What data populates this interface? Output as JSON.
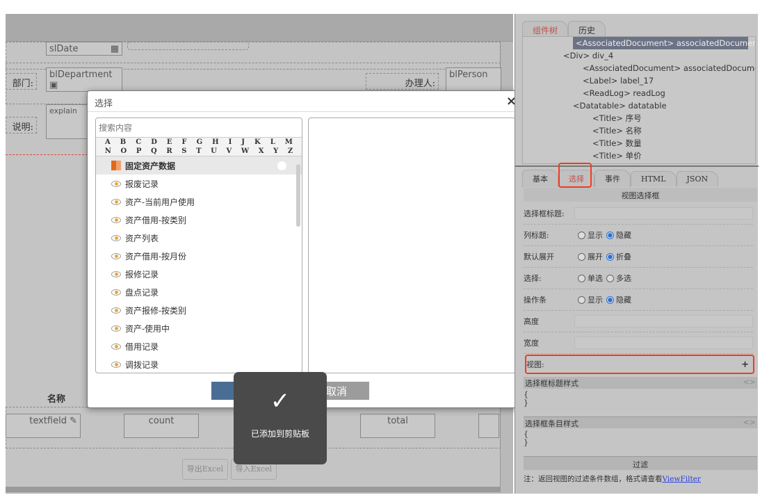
{
  "form": {
    "slDate": "slDate",
    "department_label": "部门:",
    "blDepartment": "blDepartment",
    "handler_label": "办理人:",
    "blPerson": "blPerson",
    "explain_label": "说明:",
    "explain": "explain",
    "col_name": "名称",
    "textfield": "textfield",
    "count": "count",
    "total": "total",
    "export_excel": "导出Excel",
    "import_excel": "导入Excel"
  },
  "dialog": {
    "title": "选择",
    "close": "×",
    "search_placeholder": "搜索内容",
    "alphabet_row1": [
      "A",
      "B",
      "C",
      "D",
      "E",
      "F",
      "G",
      "H",
      "I",
      "J",
      "K",
      "L",
      "M"
    ],
    "alphabet_row2": [
      "N",
      "O",
      "P",
      "Q",
      "R",
      "S",
      "T",
      "U",
      "V",
      "W",
      "X",
      "Y",
      "Z"
    ],
    "items": [
      {
        "label": "固定资产数据",
        "icon": "grid-icon",
        "selected": true
      },
      {
        "label": "报废记录",
        "icon": "eye-icon"
      },
      {
        "label": "资产-当前用户使用",
        "icon": "eye-icon"
      },
      {
        "label": "资产借用-按类别",
        "icon": "eye-icon"
      },
      {
        "label": "资产列表",
        "icon": "eye-icon"
      },
      {
        "label": "资产借用-按月份",
        "icon": "eye-icon"
      },
      {
        "label": "报修记录",
        "icon": "eye-icon"
      },
      {
        "label": "盘点记录",
        "icon": "eye-icon"
      },
      {
        "label": "资产报修-按类别",
        "icon": "eye-icon"
      },
      {
        "label": "资产-使用中",
        "icon": "eye-icon"
      },
      {
        "label": "借用记录",
        "icon": "eye-icon"
      },
      {
        "label": "调拨记录",
        "icon": "eye-icon"
      }
    ],
    "cancel": "取消"
  },
  "toast": {
    "message": "已添加到剪贴板",
    "icon": "checkmark-icon"
  },
  "panel": {
    "tabs_top": [
      "组件树",
      "历史"
    ],
    "tree": [
      {
        "label": "<AssociatedDocument> associatedDocument",
        "selected": true
      },
      {
        "label": "<Div> div_4"
      },
      {
        "label": "<AssociatedDocument> associatedDocument"
      },
      {
        "label": "<Label> label_17"
      },
      {
        "label": "<ReadLog> readLog"
      },
      {
        "label": "<Datatable> datatable"
      },
      {
        "label": "<Title> 序号"
      },
      {
        "label": "<Title> 名称"
      },
      {
        "label": "<Title> 数量"
      },
      {
        "label": "<Title> 单价"
      }
    ],
    "tabs": [
      "基本",
      "选择",
      "事件",
      "HTML",
      "JSON"
    ],
    "section_title": "视图选择框",
    "fields": {
      "title_label": "选择框标题:",
      "col_title_label": "列标题:",
      "show": "显示",
      "hide": "隐藏",
      "expand_label": "默认展开",
      "expand": "展开",
      "collapse": "折叠",
      "select_label": "选择:",
      "single": "单选",
      "multi": "多选",
      "toolbar_label": "操作条",
      "height_label": "高度",
      "width_label": "宽度",
      "view_label": "视图:",
      "add": "+"
    },
    "title_style": "选择框标题样式",
    "item_style": "选择框条目样式",
    "brace_open": "{",
    "brace_close": "}",
    "code_icon": "<>",
    "filter": "过滤",
    "note": "注：返回视图的过滤条件数组，格式请查看",
    "note_link": "ViewFilter"
  },
  "colors": {
    "accent_red": "#f03c1e",
    "radio_blue": "#2a6fd6",
    "ok_button": "#4a6d94",
    "link": "#2a3ee0"
  }
}
